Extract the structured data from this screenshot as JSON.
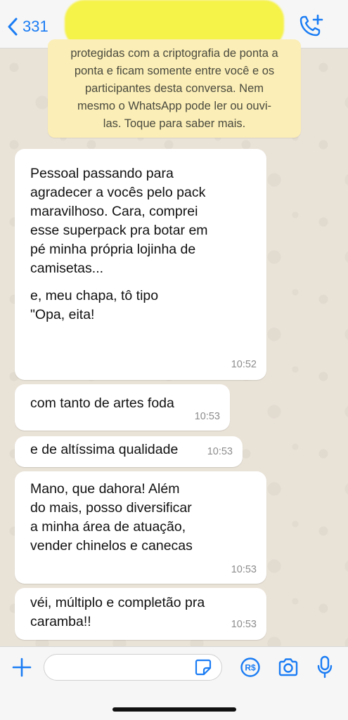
{
  "header": {
    "back_count": "331",
    "back_icon": "chevron-left-icon",
    "call_icon": "phone-add-icon",
    "accent": "#1a7cf4"
  },
  "notice": {
    "lines": [
      "protegidas com a criptografia de ponta a",
      "ponta e ficam somente entre você e os",
      "participantes desta conversa. Nem",
      "mesmo o WhatsApp pode ler ou ouvi-",
      "las. Toque para saber mais."
    ]
  },
  "messages": [
    {
      "lines": [
        "Pessoal passando para",
        "agradecer a vocês pelo pack",
        "maravilhoso. Cara, comprei",
        "esse superpack pra botar em",
        "pé minha própria lojinha de",
        "camisetas..."
      ],
      "lines2": [
        "e, meu chapa, tô tipo",
        "\"Opa, eita!"
      ],
      "time": "10:52"
    },
    {
      "lines": [
        "com tanto de artes foda"
      ],
      "time": "10:53"
    },
    {
      "lines": [
        "e de altíssima qualidade"
      ],
      "time": "10:53"
    },
    {
      "lines": [
        "Mano, que dahora! Além",
        "do mais, posso diversificar",
        "a minha área de atuação,",
        "vender chinelos e canecas"
      ],
      "time": "10:53"
    },
    {
      "lines": [
        "véi, múltiplo e completão pra",
        "caramba!!"
      ],
      "time": "10:53"
    }
  ],
  "input_bar": {
    "message_value": "",
    "icons": [
      "plus-icon",
      "sticker-icon",
      "pix-icon",
      "camera-icon",
      "microphone-icon"
    ]
  }
}
